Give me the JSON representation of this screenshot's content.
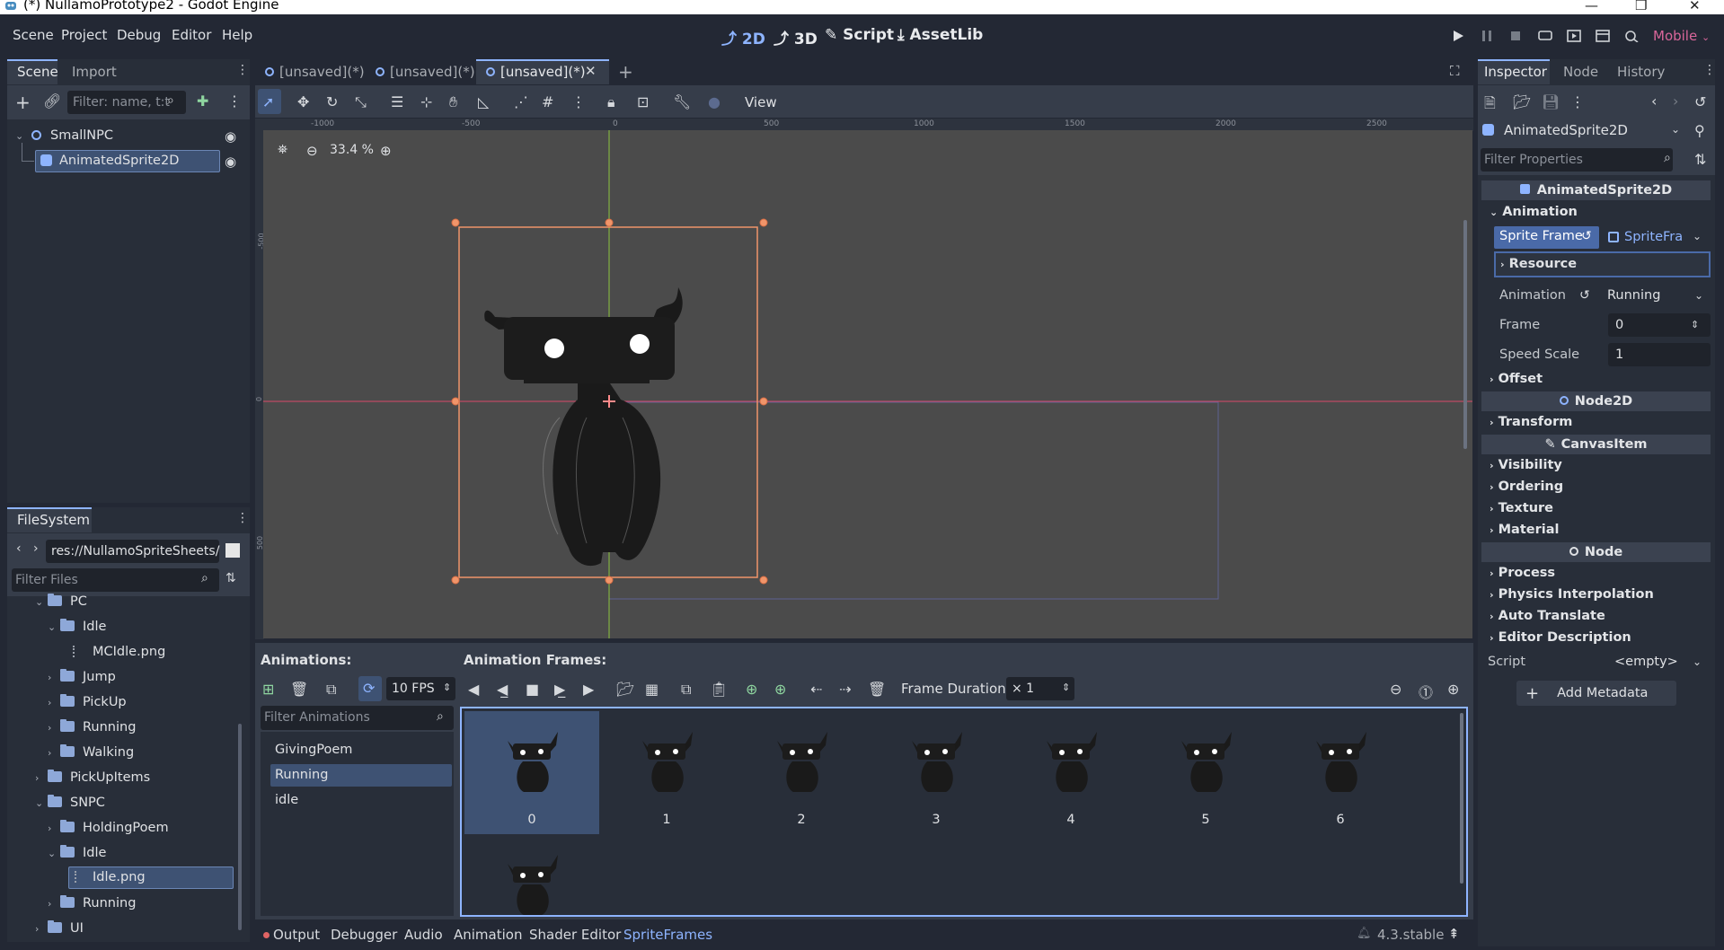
{
  "window": {
    "title": "(*) NullamoPrototype2 - Godot Engine"
  },
  "menu": {
    "items": [
      "Scene",
      "Project",
      "Debug",
      "Editor",
      "Help"
    ]
  },
  "workspaces": {
    "items": [
      "2D",
      "3D",
      "Script",
      "AssetLib"
    ],
    "active": "2D"
  },
  "renderer": "Mobile",
  "scene_dock": {
    "tabs": [
      "Scene",
      "Import"
    ],
    "filter_placeholder": "Filter: name, t:t",
    "tree": [
      "SmallNPC",
      "AnimatedSprite2D"
    ]
  },
  "filesystem": {
    "tab": "FileSystem",
    "path": "res://NullamoSpriteSheets/",
    "filter_placeholder": "Filter Files",
    "items": [
      "PC",
      "Idle",
      "MCIdle.png",
      "Jump",
      "PickUp",
      "Running",
      "Walking",
      "PickUpItems",
      "SNPC",
      "HoldingPoem",
      "Idle",
      "Idle.png",
      "Running",
      "UI"
    ]
  },
  "editor_tabs": [
    "[unsaved](*)",
    "[unsaved](*)",
    "[unsaved](*)"
  ],
  "toolbar": {
    "view_label": "View"
  },
  "viewport": {
    "zoom": "33.4 %",
    "ruler_labels": [
      "-1000",
      "-500",
      "0",
      "500",
      "1000",
      "1500",
      "2000",
      "2500"
    ],
    "vruler_labels": [
      "-500",
      "0",
      "500"
    ]
  },
  "inspector": {
    "tabs": [
      "Inspector",
      "Node",
      "History"
    ],
    "node_type": "AnimatedSprite2D",
    "filter_placeholder": "Filter Properties",
    "header": "AnimatedSprite2D",
    "animation_category": "Animation",
    "sprite_frames_label": "Sprite Frame",
    "sprite_frames_value": "SpriteFra",
    "resource_label": "Resource",
    "animation_label": "Animation",
    "animation_value": "Running",
    "frame_label": "Frame",
    "frame_value": "0",
    "speed_label": "Speed Scale",
    "speed_value": "1",
    "offset": "Offset",
    "node2d": "Node2D",
    "transform": "Transform",
    "canvasitem": "CanvasItem",
    "visibility": "Visibility",
    "ordering": "Ordering",
    "texture": "Texture",
    "material": "Material",
    "node": "Node",
    "process": "Process",
    "physics": "Physics Interpolation",
    "auto_translate": "Auto Translate",
    "editor_description": "Editor Description",
    "script_label": "Script",
    "script_value": "<empty>",
    "add_metadata": "Add Metadata"
  },
  "sprite_frames_panel": {
    "animations_title": "Animations:",
    "frames_title": "Animation Frames:",
    "fps": "10 FPS",
    "frame_duration_label": "Frame Duration:",
    "frame_duration_value": "× 1",
    "filter_placeholder": "Filter Animations",
    "animations": [
      "GivingPoem",
      "Running",
      "idle"
    ],
    "selected_animation": "Running",
    "frames": [
      "0",
      "1",
      "2",
      "3",
      "4",
      "5",
      "6",
      ""
    ]
  },
  "bottom_tabs": [
    "Output",
    "Debugger",
    "Audio",
    "Animation",
    "Shader Editor",
    "SpriteFrames"
  ],
  "version": "4.3.stable",
  "colors": {
    "accent": "#8eb4ff",
    "selection": "#3e5273",
    "sprite_outline": "#f0956a",
    "axis_x": "#d9496a",
    "axis_y": "#8cc63f"
  }
}
